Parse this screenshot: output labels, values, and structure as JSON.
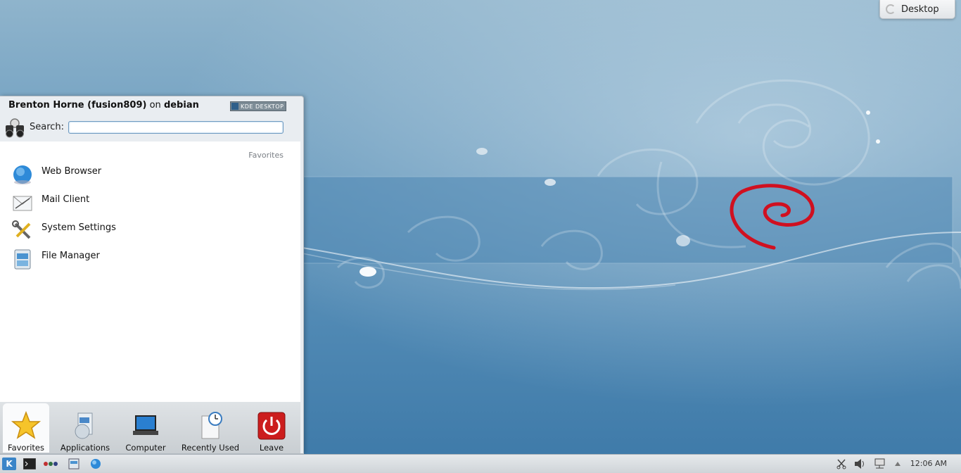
{
  "desktop_toolbox": {
    "label": "Desktop"
  },
  "kickoff": {
    "user_name": "Brenton Horne (fusion809)",
    "on_word": "on",
    "host": "debian",
    "badge_text": "KDE DESKTOP",
    "search": {
      "label": "Search:",
      "value": "",
      "placeholder": ""
    },
    "favorites_header": "Favorites",
    "favorites": [
      {
        "label": "Web Browser",
        "icon": "globe-icon"
      },
      {
        "label": "Mail Client",
        "icon": "mail-icon"
      },
      {
        "label": "System Settings",
        "icon": "tools-icon"
      },
      {
        "label": "File Manager",
        "icon": "file-manager-icon"
      }
    ],
    "tabs": [
      {
        "label": "Favorites",
        "icon": "star-icon",
        "active": true
      },
      {
        "label": "Applications",
        "icon": "applications-icon",
        "active": false
      },
      {
        "label": "Computer",
        "icon": "laptop-icon",
        "active": false
      },
      {
        "label": "Recently Used",
        "icon": "clock-document-icon",
        "active": false
      },
      {
        "label": "Leave",
        "icon": "power-icon",
        "active": false
      }
    ]
  },
  "taskbar": {
    "clock": "12:06 AM",
    "items": [
      "kde-launcher-icon",
      "terminal-icon",
      "pager-icon",
      "file-manager-icon",
      "globe-icon"
    ],
    "tray": [
      "scissors-icon",
      "volume-icon",
      "network-icon",
      "tray-arrow-icon"
    ]
  },
  "colors": {
    "wallpaper": "#5b8fb7",
    "debian_swirl": "#d01020"
  }
}
